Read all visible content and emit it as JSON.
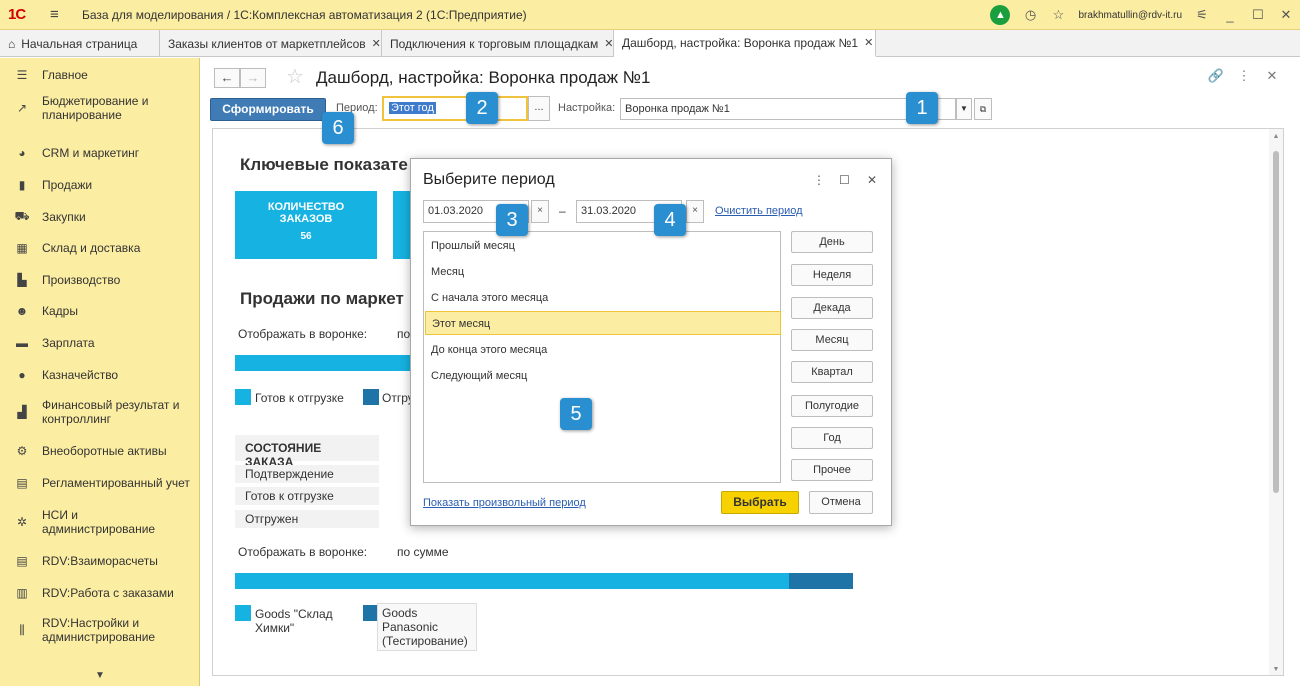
{
  "titlebar": {
    "logo": "1С",
    "title": "База для моделирования / 1С:Комплексная автоматизация 2  (1С:Предприятие)",
    "user": "brakhmatullin@rdv-it.ru"
  },
  "tabs": [
    {
      "label": "Начальная страница"
    },
    {
      "label": "Заказы клиентов от маркетплейсов"
    },
    {
      "label": "Подключения к торговым площадкам"
    },
    {
      "label": "Дашборд, настройка: Воронка продаж №1"
    }
  ],
  "sidebar": {
    "items": [
      {
        "label": "Главное",
        "icon": "☰"
      },
      {
        "label": "Бюджетирование и планирование",
        "icon": "↗"
      },
      {
        "label": "CRM и маркетинг",
        "icon": "◕"
      },
      {
        "label": "Продажи",
        "icon": "▮"
      },
      {
        "label": "Закупки",
        "icon": "⛟"
      },
      {
        "label": "Склад и доставка",
        "icon": "▦"
      },
      {
        "label": "Производство",
        "icon": "▙"
      },
      {
        "label": "Кадры",
        "icon": "☻"
      },
      {
        "label": "Зарплата",
        "icon": "▬"
      },
      {
        "label": "Казначейство",
        "icon": "●"
      },
      {
        "label": "Финансовый результат и контроллинг",
        "icon": "▟"
      },
      {
        "label": "Внеоборотные активы",
        "icon": "⚙"
      },
      {
        "label": "Регламентированный учет",
        "icon": "▤"
      },
      {
        "label": "НСИ и администрирование",
        "icon": "✲"
      },
      {
        "label": "RDV:Взаиморасчеты",
        "icon": "▤"
      },
      {
        "label": "RDV:Работа с заказами",
        "icon": "▥"
      },
      {
        "label": "RDV:Настройки и администрирование",
        "icon": "⫼"
      }
    ]
  },
  "header": {
    "title": "Дашборд, настройка: Воронка продаж №1"
  },
  "toolbar": {
    "generate_label": "Сформировать",
    "period_label": "Период:",
    "period_value": "Этот год",
    "period_dots": "...",
    "setting_label": "Настройка:",
    "setting_value": "Воронка продаж №1"
  },
  "report": {
    "kpi_title": "Ключевые показате",
    "kpi_card_line1": "КОЛИЧЕСТВО",
    "kpi_card_line2": "ЗАКАЗОВ",
    "kpi_card_value": "56",
    "sales_title": "Продажи по маркет",
    "funnel_label": "Отображать в воронке:",
    "funnel_value_cut": "по",
    "legend_ready": "Готов к отгрузке",
    "legend_shipped_cut": "Отгру",
    "state_header": "СОСТОЯНИЕ ЗАКАЗА",
    "state_rows": [
      "Подтверждение",
      "Готов к отгрузке",
      "Отгружен"
    ],
    "funnel_label2": "Отображать в воронке:",
    "funnel_value2": "по сумме",
    "legend_goods1": "Goods \"Склад Химки\"",
    "legend_goods2": "Goods Panasonic (Тестирование)"
  },
  "dialog": {
    "title": "Выберите период",
    "date_from": "01.03.2020",
    "date_to": "31.03.2020",
    "dash": "–",
    "clear_link": "Очистить период",
    "options": [
      "Прошлый месяц",
      "Месяц",
      "С начала этого месяца",
      "Этот месяц",
      "До конца этого месяца",
      "Следующий месяц"
    ],
    "selected_option": "Этот месяц",
    "period_buttons": [
      "День",
      "Неделя",
      "Декада",
      "Месяц",
      "Квартал",
      "Полугодие",
      "Год",
      "Прочее"
    ],
    "custom_link": "Показать произвольный период",
    "ok_label": "Выбрать",
    "cancel_label": "Отмена"
  },
  "callouts": [
    "1",
    "2",
    "3",
    "4",
    "5",
    "6"
  ],
  "colors": {
    "accent": "#fbeda2",
    "kpi_blue": "#16b3e2",
    "dark_blue": "#1e74a6",
    "callout": "#2a8fd0",
    "ok_yellow": "#f7d100"
  }
}
